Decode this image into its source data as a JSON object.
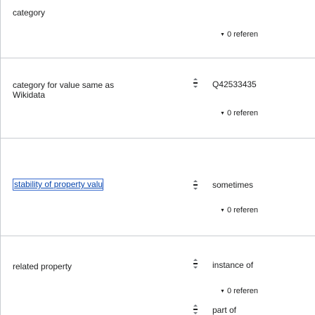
{
  "statements": [
    {
      "property": "category",
      "value": "",
      "references": "0 referen"
    },
    {
      "property": "category for value same as Wikidata",
      "value": "Q42533435",
      "references": "0 referen"
    },
    {
      "property": "stability of property value",
      "value": "sometimes",
      "references": "0 referen"
    },
    {
      "property": "related property",
      "value": "instance of",
      "references": "0 referen"
    },
    {
      "property": "",
      "value": "part of",
      "references": ""
    }
  ],
  "category_lines": [
    "category"
  ],
  "cat_same_lines": [
    "category for value same as",
    "Wikidata"
  ],
  "colors": {
    "border": "#c8ccd1",
    "link": "#0645ad",
    "focus": "#3366cc"
  }
}
